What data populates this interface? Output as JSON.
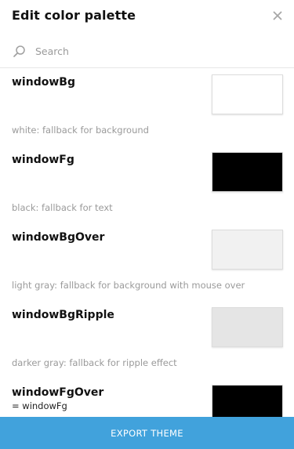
{
  "header": {
    "title": "Edit color palette",
    "close_icon": "close-icon"
  },
  "search": {
    "placeholder": "Search",
    "value": "",
    "icon": "search-icon"
  },
  "colors": [
    {
      "name": "windowBg",
      "alias": "",
      "description": "white: fallback for background",
      "color": "#ffffff"
    },
    {
      "name": "windowFg",
      "alias": "",
      "description": "black: fallback for text",
      "color": "#000000"
    },
    {
      "name": "windowBgOver",
      "alias": "",
      "description": "light gray: fallback for background with mouse over",
      "color": "#f1f1f1"
    },
    {
      "name": "windowBgRipple",
      "alias": "",
      "description": "darker gray: fallback for ripple effect",
      "color": "#e5e5e5"
    },
    {
      "name": "windowFgOver",
      "alias": "= windowFg",
      "description": "",
      "color": "#000000"
    }
  ],
  "footer": {
    "export_label": "EXPORT THEME",
    "accent": "#41a2dc"
  }
}
